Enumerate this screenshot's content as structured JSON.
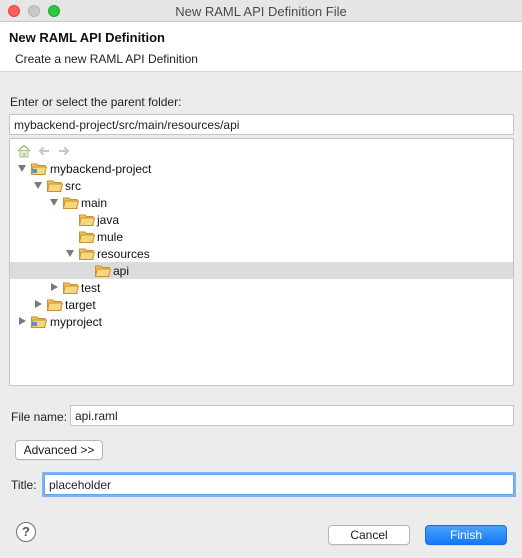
{
  "window": {
    "title": "New RAML API Definition File"
  },
  "header": {
    "title": "New RAML API Definition",
    "description": "Create a new RAML API Definition"
  },
  "parent_folder": {
    "label": "Enter or select the parent folder:",
    "value": "mybackend-project/src/main/resources/api"
  },
  "tree": {
    "rows": [
      {
        "label": "mybackend-project",
        "expanded": true,
        "type": "project"
      },
      {
        "label": "src",
        "expanded": true,
        "type": "folder"
      },
      {
        "label": "main",
        "expanded": true,
        "type": "folder"
      },
      {
        "label": "java",
        "type": "folder"
      },
      {
        "label": "mule",
        "type": "folder"
      },
      {
        "label": "resources",
        "expanded": true,
        "type": "folder"
      },
      {
        "label": "api",
        "selected": true,
        "type": "folder"
      },
      {
        "label": "test",
        "expanded": false,
        "type": "folder"
      },
      {
        "label": "target",
        "expanded": false,
        "type": "folder"
      },
      {
        "label": "myproject",
        "expanded": false,
        "type": "project"
      }
    ]
  },
  "file_name": {
    "label": "File name:",
    "value": "api.raml"
  },
  "advanced_button": "Advanced >>",
  "title_field": {
    "label": "Title:",
    "value": "placeholder"
  },
  "buttons": {
    "cancel": "Cancel",
    "finish": "Finish",
    "help": "?"
  },
  "colors": {
    "accent": "#1179f7",
    "folder": "#f3b43e",
    "selection": "#dcdcdc"
  }
}
